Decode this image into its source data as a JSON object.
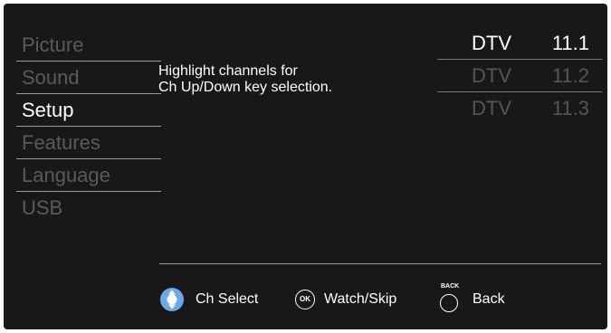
{
  "menu": {
    "items": [
      {
        "label": "Picture"
      },
      {
        "label": "Sound"
      },
      {
        "label": "Setup"
      },
      {
        "label": "Features"
      },
      {
        "label": "Language"
      },
      {
        "label": "USB"
      }
    ],
    "active_label": "Setup"
  },
  "help": {
    "line1": "Highlight channels for",
    "line2": "Ch Up/Down key selection."
  },
  "channels": [
    {
      "type": "DTV",
      "number": "11.1"
    },
    {
      "type": "DTV",
      "number": "11.2"
    },
    {
      "type": "DTV",
      "number": "11.3"
    }
  ],
  "footer": {
    "ch_select": "Ch Select",
    "ok_icon_text": "OK",
    "watch_skip": "Watch/Skip",
    "back_icon_text": "BACK",
    "back": "Back"
  },
  "icons": {
    "dpad": "dpad-icon",
    "ok": "ok-button-icon",
    "back": "back-button-icon"
  },
  "colors": {
    "background": "#181818",
    "active_text": "#ffffff",
    "inactive_text": "#5a5a5a",
    "dpad_blue": "#6fa8e8"
  }
}
